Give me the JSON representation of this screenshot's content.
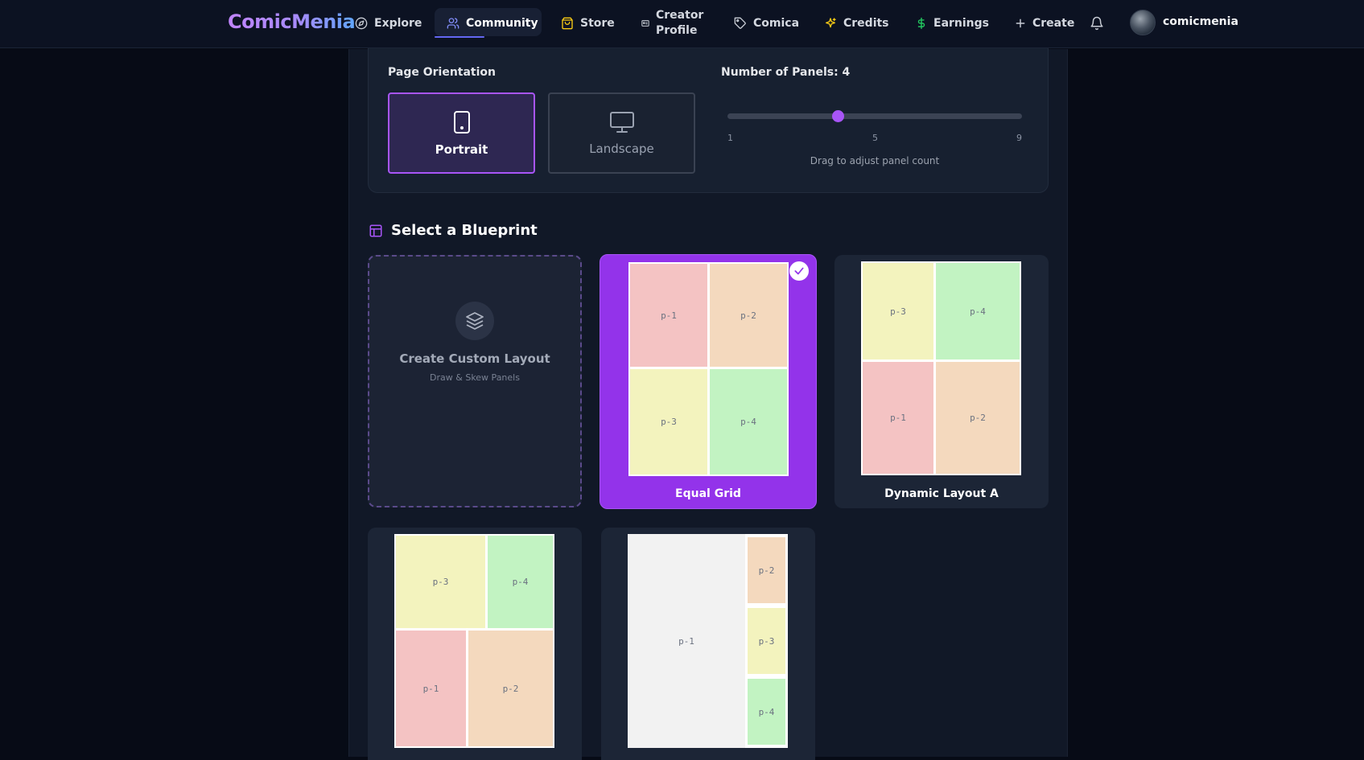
{
  "nav": {
    "brand": "ComicMenia",
    "explore": "Explore",
    "community": "Community",
    "store": "Store",
    "creator_profile_line1": "Creator",
    "creator_profile_line2": "Profile",
    "comica": "Comica",
    "credits": "Credits",
    "earnings": "Earnings",
    "create": "Create",
    "username": "comicmenia",
    "active_item": "Community"
  },
  "settings": {
    "orientation_label": "Page Orientation",
    "orientation_options": [
      "Portrait",
      "Landscape"
    ],
    "orientation_selected": "Portrait",
    "panels_label": "Number of Panels: 4",
    "panel_count": 4,
    "slider_min": 1,
    "slider_mid": 5,
    "slider_max": 9,
    "slider_min_label": "1",
    "slider_mid_label": "5",
    "slider_max_label": "9",
    "slider_hint": "Drag to adjust panel count"
  },
  "blueprints": {
    "section_title": "Select a Blueprint",
    "custom_title": "Create Custom Layout",
    "custom_subtitle": "Draw & Skew Panels",
    "selected": "Equal Grid",
    "equal_grid": {
      "name": "Equal Grid",
      "panels": [
        "p-1",
        "p-2",
        "p-3",
        "p-4"
      ]
    },
    "dynamic_a": {
      "name": "Dynamic Layout A",
      "panels": [
        "p-3",
        "p-4",
        "p-1",
        "p-2"
      ]
    },
    "layout_4": {
      "panels": [
        "p-3",
        "p-4",
        "p-1",
        "p-2"
      ]
    },
    "layout_5": {
      "panels": [
        "p-1",
        "p-2",
        "p-3",
        "p-4"
      ]
    }
  },
  "colors": {
    "accent": "#a855f7",
    "selected_card": "#9333ea",
    "panel_red": "#f4c3c3",
    "panel_orange": "#f4d9be",
    "panel_yellow": "#f3f3be",
    "panel_green": "#c2f3c2"
  },
  "icons": {
    "explore": "compass-icon",
    "community": "users-icon",
    "store": "shopping-bag-icon",
    "creator_profile": "id-card-icon",
    "comica": "tag-icon",
    "credits": "sparkles-icon",
    "earnings": "dollar-icon",
    "create": "plus-icon",
    "notifications": "bell-icon",
    "portrait": "tablet-icon",
    "landscape": "monitor-icon",
    "section": "layout-icon",
    "custom": "layers-icon",
    "selected": "check-icon"
  }
}
